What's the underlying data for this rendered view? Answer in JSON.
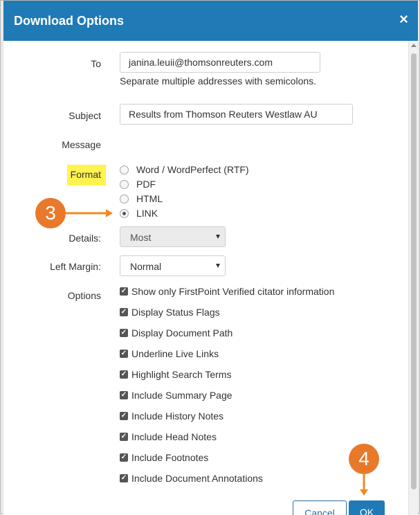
{
  "dialog": {
    "title": "Download Options",
    "close_icon": "close-icon"
  },
  "form": {
    "to_label": "To",
    "to_value": "janina.leuii@thomsonreuters.com",
    "to_hint": "Separate multiple addresses with semicolons.",
    "subject_label": "Subject",
    "subject_value": "Results from Thomson Reuters Westlaw AU",
    "message_label": "Message",
    "format_label": "Format",
    "format_options": [
      "Word / WordPerfect (RTF)",
      "PDF",
      "HTML",
      "LINK"
    ],
    "format_selected": "LINK",
    "details_label": "Details:",
    "details_value": "Most",
    "margin_label": "Left Margin:",
    "margin_value": "Normal",
    "options_label": "Options",
    "options": [
      "Show only FirstPoint Verified citator information",
      "Display Status Flags",
      "Display Document Path",
      "Underline Live Links",
      "Highlight Search Terms",
      "Include Summary Page",
      "Include History Notes",
      "Include Head Notes",
      "Include Footnotes",
      "Include Document Annotations"
    ]
  },
  "buttons": {
    "cancel_label": "Cancel",
    "ok_label": "OK"
  },
  "annotations": {
    "step_3": "3",
    "step_4": "4"
  },
  "colors": {
    "titlebar": "#1f7ab5",
    "highlight": "#fff34f",
    "annotation": "#e8792a"
  }
}
